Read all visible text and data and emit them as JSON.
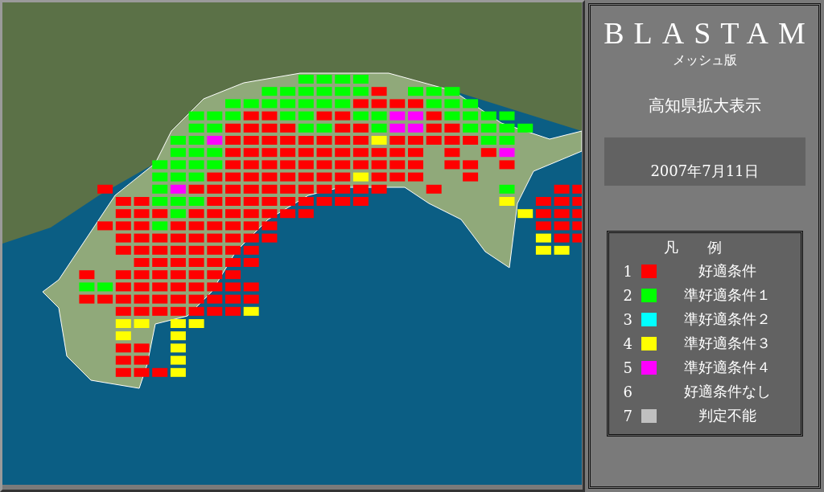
{
  "title": "BLASTAM",
  "subtitle": "メッシュ版",
  "region": "高知県拡大表示",
  "date": "2007年7月11日",
  "legend": {
    "title": "凡　　例",
    "items": [
      {
        "number": "1",
        "label": "好適条件",
        "color": "#ff0000"
      },
      {
        "number": "2",
        "label": "準好適条件１",
        "color": "#00ff00"
      },
      {
        "number": "3",
        "label": "準好適条件２",
        "color": "#00ffff"
      },
      {
        "number": "4",
        "label": "準好適条件３",
        "color": "#ffff00"
      },
      {
        "number": "5",
        "label": "準好適条件４",
        "color": "#ff00ff"
      },
      {
        "number": "6",
        "label": "好適条件なし"
      },
      {
        "number": "7",
        "label": "判定不能",
        "color": "#c0c0c0"
      }
    ]
  }
}
